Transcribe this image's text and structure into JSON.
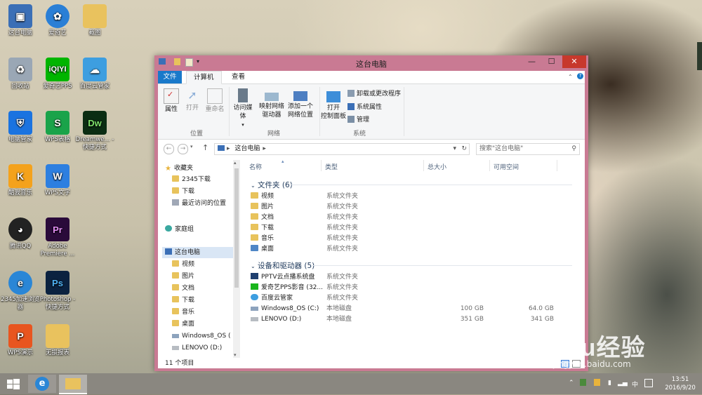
{
  "desktop": {
    "icons": [
      {
        "label": "这台电脑"
      },
      {
        "label": "爱奇艺"
      },
      {
        "label": "截图"
      },
      {
        "label": "回收站"
      },
      {
        "label": "爱奇艺PPS"
      },
      {
        "label": "百度云管家"
      },
      {
        "label": "电脑管家"
      },
      {
        "label": "WPS表格"
      },
      {
        "label": "Dreamwe... - 快捷方式"
      },
      {
        "label": "酷我音乐"
      },
      {
        "label": "WPS文字"
      },
      {
        "label": "腾讯QQ"
      },
      {
        "label": "Adobe Premiere ..."
      },
      {
        "label": "2345加速浏览器"
      },
      {
        "label": "Photoshop - 快捷方式"
      },
      {
        "label": "WPS演示"
      },
      {
        "label": "无损报表"
      }
    ]
  },
  "window": {
    "title": "这台电脑",
    "controls": {
      "minimize": "—",
      "maximize": "☐",
      "close": "✕"
    },
    "tabs": {
      "file": "文件",
      "computer": "计算机",
      "view": "查看"
    },
    "ribbon": {
      "location_group": "位置",
      "network_group": "网络",
      "system_group": "系统",
      "properties": "属性",
      "open": "打开",
      "rename": "重命名",
      "access_media": "访问媒体",
      "map_drive_line1": "映射网络",
      "map_drive_line2": "驱动器",
      "add_location_line1": "添加一个",
      "add_location_line2": "网络位置",
      "control_panel_line1": "打开",
      "control_panel_line2": "控制面板",
      "uninstall": "卸载或更改程序",
      "system_props": "系统属性",
      "manage": "管理"
    },
    "address": {
      "path": "这台电脑",
      "search_placeholder": "搜索\"这台电脑\""
    },
    "nav": {
      "favorites": "收藏夹",
      "fav_items": [
        "2345下载",
        "下载",
        "最近访问的位置"
      ],
      "homegroup": "家庭组",
      "this_pc": "这台电脑",
      "pc_items": [
        "视频",
        "图片",
        "文档",
        "下载",
        "音乐",
        "桌面",
        "Windows8_OS (",
        "LENOVO (D:)"
      ]
    },
    "columns": {
      "name": "名称",
      "type": "类型",
      "total": "总大小",
      "free": "可用空间"
    },
    "folders_group": "文件夹 (6)",
    "folders": [
      {
        "name": "视频",
        "type": "系统文件夹"
      },
      {
        "name": "图片",
        "type": "系统文件夹"
      },
      {
        "name": "文档",
        "type": "系统文件夹"
      },
      {
        "name": "下载",
        "type": "系统文件夹"
      },
      {
        "name": "音乐",
        "type": "系统文件夹"
      },
      {
        "name": "桌面",
        "type": "系统文件夹"
      }
    ],
    "devices_group": "设备和驱动器 (5)",
    "devices": [
      {
        "name": "PPTV云点播系统盘",
        "type": "系统文件夹",
        "total": "",
        "free": ""
      },
      {
        "name": "爱奇艺PPS影音 (32...",
        "type": "系统文件夹",
        "total": "",
        "free": ""
      },
      {
        "name": "百度云管家",
        "type": "系统文件夹",
        "total": "",
        "free": ""
      },
      {
        "name": "Windows8_OS (C:)",
        "type": "本地磁盘",
        "total": "100 GB",
        "free": "64.0 GB"
      },
      {
        "name": "LENOVO (D:)",
        "type": "本地磁盘",
        "total": "351 GB",
        "free": "341 GB"
      }
    ],
    "status": "11 个项目"
  },
  "taskbar": {
    "time": "13:51",
    "date": "2016/9/20",
    "ime": "中"
  },
  "watermark": {
    "brand": "Baidu经验",
    "url": "jingyan.baidu.com"
  }
}
